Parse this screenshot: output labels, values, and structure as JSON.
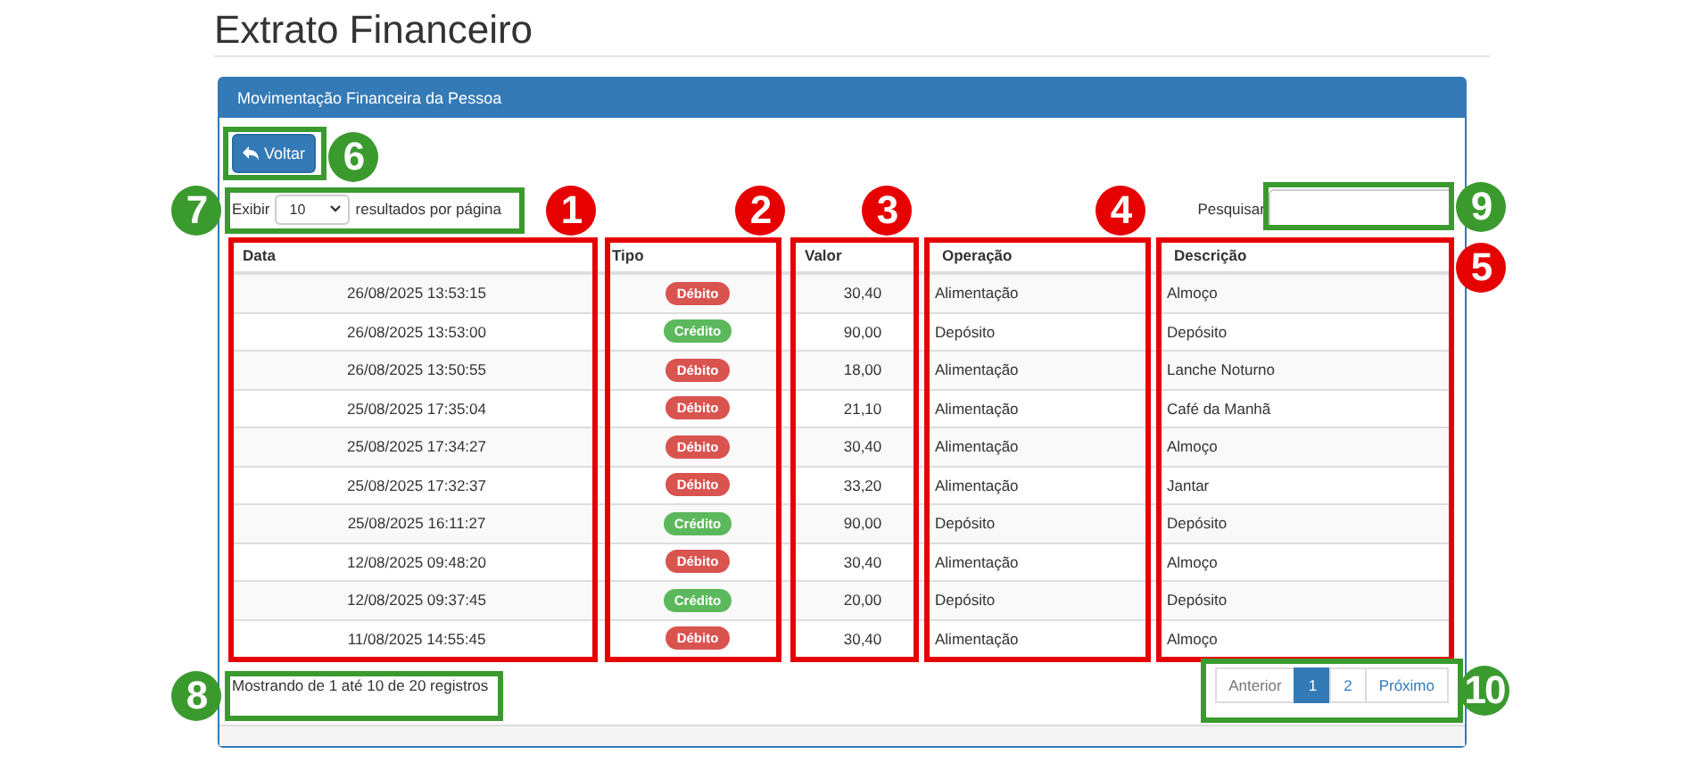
{
  "page_title": "Extrato Financeiro",
  "panel": {
    "title": "Movimentação Financeira da Pessoa"
  },
  "back_button": {
    "label": "Voltar"
  },
  "page_size": {
    "prefix": "Exibir",
    "value": "10",
    "suffix": "resultados por página"
  },
  "search": {
    "label": "Pesquisar"
  },
  "table": {
    "columns": [
      "Data",
      "Tipo",
      "Valor",
      "Operação",
      "Descrição"
    ],
    "rows": [
      {
        "date": "26/08/2025 13:53:15",
        "type": "Débito",
        "kind": "debit",
        "value": "30,40",
        "operation": "Alimentação",
        "description": "Almoço"
      },
      {
        "date": "26/08/2025 13:53:00",
        "type": "Crédito",
        "kind": "credit",
        "value": "90,00",
        "operation": "Depósito",
        "description": "Depósito"
      },
      {
        "date": "26/08/2025 13:50:55",
        "type": "Débito",
        "kind": "debit",
        "value": "18,00",
        "operation": "Alimentação",
        "description": "Lanche Noturno"
      },
      {
        "date": "25/08/2025 17:35:04",
        "type": "Débito",
        "kind": "debit",
        "value": "21,10",
        "operation": "Alimentação",
        "description": "Café da Manhã"
      },
      {
        "date": "25/08/2025 17:34:27",
        "type": "Débito",
        "kind": "debit",
        "value": "30,40",
        "operation": "Alimentação",
        "description": "Almoço"
      },
      {
        "date": "25/08/2025 17:32:37",
        "type": "Débito",
        "kind": "debit",
        "value": "33,20",
        "operation": "Alimentação",
        "description": "Jantar"
      },
      {
        "date": "25/08/2025 16:11:27",
        "type": "Crédito",
        "kind": "credit",
        "value": "90,00",
        "operation": "Depósito",
        "description": "Depósito"
      },
      {
        "date": "12/08/2025 09:48:20",
        "type": "Débito",
        "kind": "debit",
        "value": "30,40",
        "operation": "Alimentação",
        "description": "Almoço"
      },
      {
        "date": "12/08/2025 09:37:45",
        "type": "Crédito",
        "kind": "credit",
        "value": "20,00",
        "operation": "Depósito",
        "description": "Depósito"
      },
      {
        "date": "11/08/2025 14:55:45",
        "type": "Débito",
        "kind": "debit",
        "value": "30,40",
        "operation": "Alimentação",
        "description": "Almoço"
      }
    ]
  },
  "summary": "Mostrando de 1 até 10 de 20 registros",
  "pagination": [
    {
      "label": "Anterior",
      "selected": false
    },
    {
      "label": "1",
      "selected": true
    },
    {
      "label": "2",
      "selected": false
    },
    {
      "label": "Próximo",
      "selected": false
    }
  ],
  "annotations": [
    {
      "label": "1",
      "color": "#e60000"
    },
    {
      "label": "2",
      "color": "#e60000"
    },
    {
      "label": "3",
      "color": "#e60000"
    },
    {
      "label": "4",
      "color": "#e60000"
    },
    {
      "label": "5",
      "color": "#e60000"
    },
    {
      "label": "6",
      "color": "#3a9a2e"
    },
    {
      "label": "7",
      "color": "#3a9a2e"
    },
    {
      "label": "8",
      "color": "#3a9a2e"
    },
    {
      "label": "9",
      "color": "#3a9a2e"
    },
    {
      "label": "10",
      "color": "#3a9a2e"
    }
  ]
}
